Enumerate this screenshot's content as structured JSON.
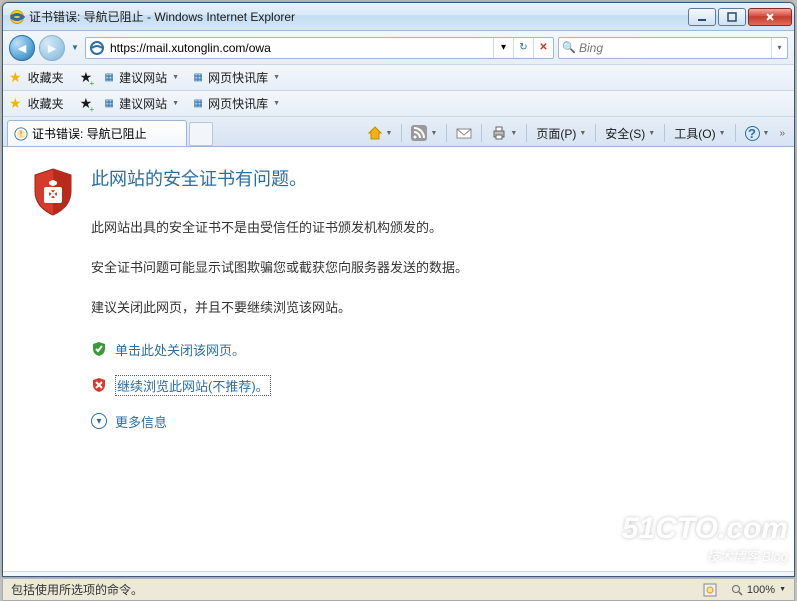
{
  "window": {
    "title": "证书错误: 导航已阻止 - Windows Internet Explorer"
  },
  "nav": {
    "url": "https://mail.xutonglin.com/owa",
    "search_placeholder": "Bing"
  },
  "favorites": {
    "label": "收藏夹",
    "suggested": "建议网站",
    "gallery": "网页快讯库"
  },
  "tab": {
    "title": "证书错误: 导航已阻止"
  },
  "toolbar": {
    "page": "页面(P)",
    "safety": "安全(S)",
    "tools": "工具(O)"
  },
  "cert": {
    "heading": "此网站的安全证书有问题。",
    "p1": "此网站出具的安全证书不是由受信任的证书颁发机构颁发的。",
    "p2": "安全证书问题可能显示试图欺骗您或截获您向服务器发送的数据。",
    "p3": "建议关闭此网页，并且不要继续浏览该网站。",
    "close_link": "单击此处关闭该网页。",
    "continue_link": "继续浏览此网站(不推荐)。",
    "more": "更多信息"
  },
  "status": {
    "message": "包括使用所选项的命令。",
    "zoom": "100%"
  },
  "watermark": {
    "main": "51CTO.com",
    "sub": "技术博客  Blog"
  }
}
